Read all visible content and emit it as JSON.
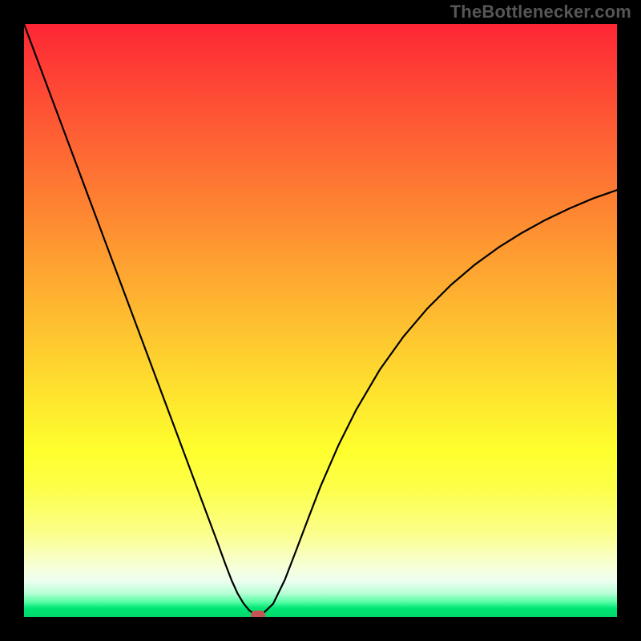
{
  "attribution": "TheBottlenecker.com",
  "chart_data": {
    "type": "line",
    "title": "",
    "xlabel": "",
    "ylabel": "",
    "xlim": [
      0,
      100
    ],
    "ylim": [
      0,
      100
    ],
    "series": [
      {
        "name": "bottleneck-curve",
        "x": [
          0,
          2.5,
          5,
          7.5,
          10,
          12.5,
          15,
          17.5,
          20,
          22.5,
          25,
          27.5,
          30,
          32.5,
          34,
          35,
          36,
          37,
          38,
          39,
          40,
          42,
          44,
          46,
          48,
          50,
          53,
          56,
          60,
          64,
          68,
          72,
          76,
          80,
          84,
          88,
          92,
          96,
          100
        ],
        "values": [
          100,
          93.3,
          86.6,
          79.9,
          73.2,
          66.5,
          59.8,
          53.1,
          46.4,
          39.7,
          33.0,
          26.3,
          19.6,
          12.9,
          8.8,
          6.2,
          4.0,
          2.3,
          1.1,
          0.4,
          0.3,
          2.2,
          6.3,
          11.5,
          16.8,
          22.0,
          28.9,
          34.9,
          41.7,
          47.3,
          52.0,
          56.0,
          59.4,
          62.3,
          64.8,
          67.0,
          68.9,
          70.6,
          72.0
        ]
      }
    ],
    "marker": {
      "x": 39.5,
      "y": 0.3
    },
    "gradient_stops": [
      {
        "pct": 0,
        "color": "#fe2635"
      },
      {
        "pct": 50,
        "color": "#fecc2f"
      },
      {
        "pct": 72,
        "color": "#feff2d"
      },
      {
        "pct": 94,
        "color": "#ecfff0"
      },
      {
        "pct": 100,
        "color": "#00d86a"
      }
    ]
  }
}
